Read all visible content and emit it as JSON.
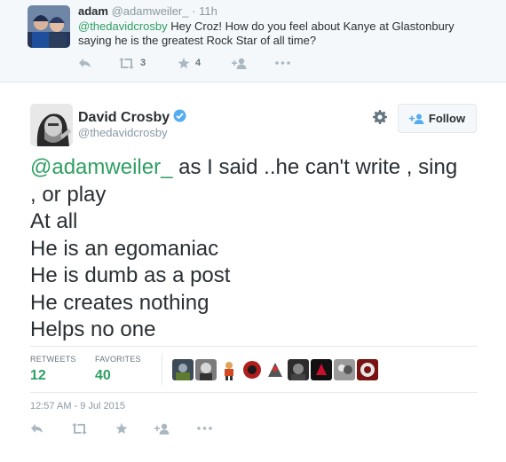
{
  "reply": {
    "name": "adam",
    "handle": "@adamweiler_",
    "separator": "·",
    "time": "11h",
    "mention": "@thedavidcrosby",
    "text_line1_rest": " Hey Croz! How do you feel about Kanye at Glastonbury",
    "text_line2": "saying he is the greatest Rock Star of all time?",
    "retweet_count": "3",
    "favorite_count": "4"
  },
  "tweet": {
    "name": "David Crosby",
    "handle": "@thedavidcrosby",
    "follow_label": "Follow",
    "mention": "@adamweiler_",
    "line1_rest": " as I said ..he can't write , sing",
    "line2": ", or play",
    "line3": "At all",
    "line4": "He is an egomaniac",
    "line5": "He is dumb as a post",
    "line6": "He creates nothing",
    "line7": "Helps no one",
    "retweets_label": "RETWEETS",
    "retweets": "12",
    "favorites_label": "FAVORITES",
    "favorites": "40",
    "timestamp": "12:57 AM - 9 Jul 2015"
  },
  "colors": {
    "accent_green": "#2f9f62",
    "verified_blue": "#55acee",
    "muted": "#8899a6",
    "icon_gray": "#aab8c2",
    "reply_bg": "#f5f8fa"
  },
  "icons": [
    "reply-icon",
    "retweet-icon",
    "star-icon",
    "follow-icon",
    "more-icon",
    "gear-icon",
    "verified-badge-icon"
  ]
}
